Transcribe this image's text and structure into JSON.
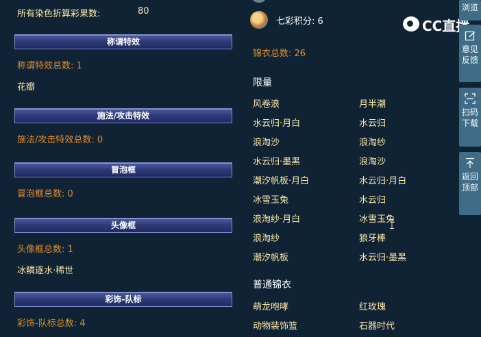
{
  "left": {
    "all_dye_label": "所有染色折算彩果数:",
    "all_dye_value": "80",
    "sections": [
      {
        "title": "称谓特效",
        "total": "称谓特效总数: 1",
        "items": [
          "花瓣"
        ]
      },
      {
        "title": "施法/攻击特效",
        "total": "施法/攻击特效总数: 0",
        "items": []
      },
      {
        "title": "冒泡框",
        "total": "冒泡框总数: 0",
        "items": []
      },
      {
        "title": "头像框",
        "total": "头像框总数: 1",
        "items": [
          "冰鳞逐水·稀世"
        ]
      },
      {
        "title": "彩饰-队标",
        "total": "彩饰-队标总数: 4",
        "items": []
      }
    ]
  },
  "right": {
    "qicai_label": "七彩积分: 6",
    "jinyi_total": "锦衣总数: 26",
    "limited_heading": "限量",
    "limited_items": [
      [
        "风卷浪",
        "月半潮"
      ],
      [
        "水云归·月白",
        "水云归"
      ],
      [
        "浪淘沙",
        "浪淘纱"
      ],
      [
        "水云归·墨黑",
        "浪淘沙"
      ],
      [
        "潮汐帆板·月白",
        "水云归·月白"
      ],
      [
        "冰雪玉兔",
        "水云归"
      ],
      [
        "浪淘纱·月白",
        "冰雪玉兔"
      ],
      [
        "浪淘纱",
        "狼牙棒"
      ],
      [
        "潮汐帆板",
        "水云归·墨黑"
      ]
    ],
    "normal_heading": "普通锦衣",
    "normal_items": [
      [
        "萌龙咆哮",
        "红玫瑰"
      ],
      [
        "动物装饰篮",
        "石器时代"
      ]
    ]
  },
  "logo": {
    "text": "CC直播"
  },
  "sidebar": {
    "browse": "浏览",
    "feedback": [
      "意见",
      "反馈"
    ],
    "scan": [
      "扫码",
      "下载"
    ],
    "top": [
      "返回",
      "顶部"
    ]
  },
  "icons": {
    "feedback": "edit-icon",
    "scan": "scan-icon",
    "top": "arrow-up-icon",
    "qicai": "qicai-badge-icon"
  }
}
